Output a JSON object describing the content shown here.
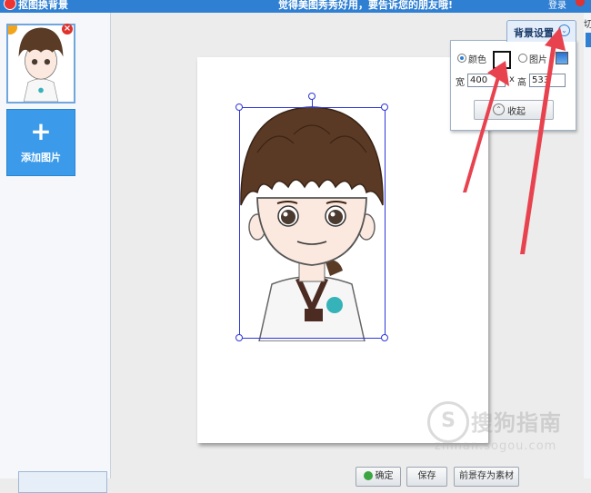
{
  "titlebar": {
    "app_title": "抠图换背景",
    "tagline": "觉得美图秀秀好用，要告诉您的朋友哦!",
    "login": "登录"
  },
  "left_panel": {
    "add_label": "添加图片",
    "add_plus": "+"
  },
  "thumbnail": {
    "close": "×"
  },
  "bg_settings": {
    "tab_label": "背景设置",
    "color_label": "颜色",
    "picture_label": "图片",
    "width_label": "宽",
    "width_value": "400",
    "times": "x",
    "height_label": "高",
    "height_value": "533",
    "collapse_label": "收起",
    "color_selected": true,
    "swatch_color": "#ffffff"
  },
  "right_strip": {
    "label": "切"
  },
  "bottom_buttons": {
    "ok": "确定",
    "save": "保存",
    "save_material": "前景存为素材"
  },
  "watermark": {
    "logo": "S",
    "text": "搜狗指南",
    "url": "zhinan.sogou.com"
  },
  "colors": {
    "accent": "#2f7fd2",
    "selection": "#2e37d8",
    "arrow": "#e8424f",
    "add_button": "#3b9bea"
  }
}
